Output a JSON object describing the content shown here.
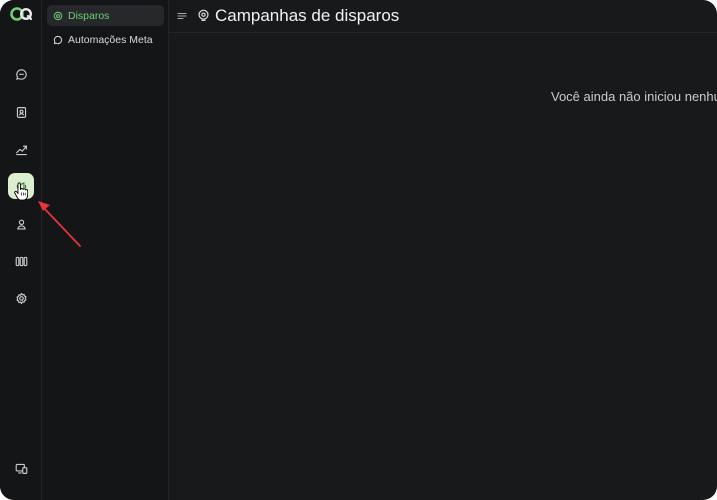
{
  "app": {
    "accent_color": "#6fcf73",
    "active_rail_color": "#dbeecf",
    "annotation_color": "#e8333a"
  },
  "rail": {
    "items": [
      {
        "icon": "chat-bubble-icon"
      },
      {
        "icon": "contacts-icon"
      },
      {
        "icon": "trending-up-icon"
      },
      {
        "icon": "megaphone-icon",
        "active": true
      },
      {
        "icon": "team-icon"
      },
      {
        "icon": "kanban-columns-icon"
      },
      {
        "icon": "gear-icon"
      },
      {
        "icon": "devices-icon"
      }
    ]
  },
  "subnav": {
    "items": [
      {
        "label": "Disparos",
        "icon": "broadcast-icon",
        "active": true
      },
      {
        "label": "Automações Meta",
        "icon": "chat-bubble-icon"
      }
    ]
  },
  "header": {
    "title": "Campanhas de disparos",
    "title_icon": "broadcast-icon"
  },
  "main": {
    "empty_message": "Você ainda não iniciou nenhuma campanha"
  }
}
